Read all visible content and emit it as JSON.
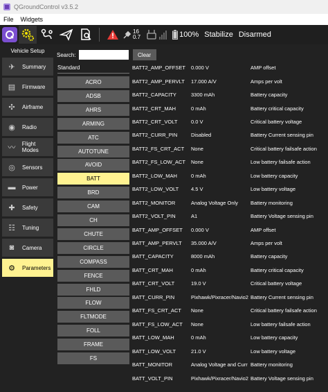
{
  "window": {
    "title": "QGroundControl v3.5.2"
  },
  "menu": {
    "file": "File",
    "widgets": "Widgets"
  },
  "status": {
    "sats_top": "16",
    "sats_bottom": "0.7",
    "battery": "100%",
    "mode": "Stabilize",
    "armed": "Disarmed"
  },
  "sidebar": {
    "title": "Vehicle Setup",
    "items": [
      {
        "label": "Summary",
        "icon": "summary-icon",
        "glyph": "✈"
      },
      {
        "label": "Firmware",
        "icon": "firmware-icon",
        "glyph": "▤"
      },
      {
        "label": "Airframe",
        "icon": "airframe-icon",
        "glyph": "✣"
      },
      {
        "label": "Radio",
        "icon": "radio-icon",
        "glyph": "◉"
      },
      {
        "label": "Flight Modes",
        "icon": "flight-modes-icon",
        "glyph": "〰"
      },
      {
        "label": "Sensors",
        "icon": "sensors-icon",
        "glyph": "◎"
      },
      {
        "label": "Power",
        "icon": "power-icon",
        "glyph": "▬"
      },
      {
        "label": "Safety",
        "icon": "safety-icon",
        "glyph": "✚"
      },
      {
        "label": "Tuning",
        "icon": "tuning-icon",
        "glyph": "☷"
      },
      {
        "label": "Camera",
        "icon": "camera-icon",
        "glyph": "◙"
      },
      {
        "label": "Parameters",
        "icon": "parameters-icon",
        "glyph": "⚙"
      }
    ],
    "selected_index": 10
  },
  "search": {
    "label": "Search:",
    "value": "",
    "clear_label": "Clear"
  },
  "group_header": "Standard",
  "groups": [
    "ACRO",
    "ADSB",
    "AHRS",
    "ARMING",
    "ATC",
    "AUTOTUNE",
    "AVOID",
    "BATT",
    "BRD",
    "CAM",
    "CH",
    "CHUTE",
    "CIRCLE",
    "COMPASS",
    "FENCE",
    "FHLD",
    "FLOW",
    "FLTMODE",
    "FOLL",
    "FRAME",
    "FS"
  ],
  "selected_group": "BATT",
  "params": [
    {
      "name": "BATT2_AMP_OFFSET",
      "value": "0.000 V",
      "desc": "AMP offset"
    },
    {
      "name": "BATT2_AMP_PERVLT",
      "value": "17.000 A/V",
      "desc": "Amps per volt"
    },
    {
      "name": "BATT2_CAPACITY",
      "value": "3300 mAh",
      "desc": "Battery capacity"
    },
    {
      "name": "BATT2_CRT_MAH",
      "value": "0 mAh",
      "desc": "Battery critical capacity"
    },
    {
      "name": "BATT2_CRT_VOLT",
      "value": "0.0 V",
      "desc": "Critical battery voltage"
    },
    {
      "name": "BATT2_CURR_PIN",
      "value": "Disabled",
      "desc": "Battery Current sensing pin"
    },
    {
      "name": "BATT2_FS_CRT_ACT",
      "value": "None",
      "desc": "Critical battery failsafe action"
    },
    {
      "name": "BATT2_FS_LOW_ACT",
      "value": "None",
      "desc": "Low battery failsafe action"
    },
    {
      "name": "BATT2_LOW_MAH",
      "value": "0 mAh",
      "desc": "Low battery capacity"
    },
    {
      "name": "BATT2_LOW_VOLT",
      "value": "4.5 V",
      "desc": "Low battery voltage"
    },
    {
      "name": "BATT2_MONITOR",
      "value": "Analog Voltage Only",
      "desc": "Battery monitoring"
    },
    {
      "name": "BATT2_VOLT_PIN",
      "value": "A1",
      "desc": "Battery Voltage sensing pin"
    },
    {
      "name": "BATT_AMP_OFFSET",
      "value": "0.000 V",
      "desc": "AMP offset"
    },
    {
      "name": "BATT_AMP_PERVLT",
      "value": "35.000 A/V",
      "desc": "Amps per volt"
    },
    {
      "name": "BATT_CAPACITY",
      "value": "8000 mAh",
      "desc": "Battery capacity"
    },
    {
      "name": "BATT_CRT_MAH",
      "value": "0 mAh",
      "desc": "Battery critical capacity"
    },
    {
      "name": "BATT_CRT_VOLT",
      "value": "19.0 V",
      "desc": "Critical battery voltage"
    },
    {
      "name": "BATT_CURR_PIN",
      "value": "Pixhawk/Pixracer/Navio2",
      "desc": "Battery Current sensing pin"
    },
    {
      "name": "BATT_FS_CRT_ACT",
      "value": "None",
      "desc": "Critical battery failsafe action"
    },
    {
      "name": "BATT_FS_LOW_ACT",
      "value": "None",
      "desc": "Low battery failsafe action"
    },
    {
      "name": "BATT_LOW_MAH",
      "value": "0 mAh",
      "desc": "Low battery capacity"
    },
    {
      "name": "BATT_LOW_VOLT",
      "value": "21.0 V",
      "desc": "Low battery voltage"
    },
    {
      "name": "BATT_MONITOR",
      "value": "Analog Voltage and Curr",
      "desc": "Battery monitoring"
    },
    {
      "name": "BATT_VOLT_PIN",
      "value": "Pixhawk/Pixracer/Navio2",
      "desc": "Battery Voltage sensing pin"
    }
  ],
  "colors": {
    "selected": "#fff291",
    "accent": "#7b4fd0",
    "warning": "#e53935"
  }
}
